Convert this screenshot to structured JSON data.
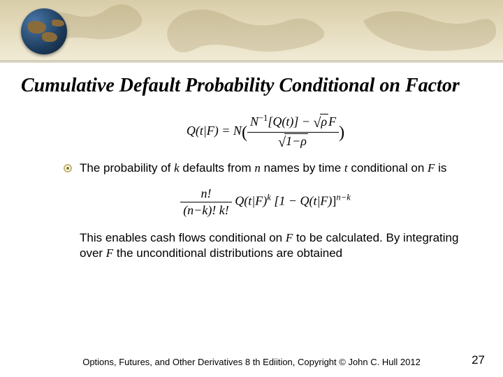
{
  "title": "Cumulative Default Probability Conditional on Factor",
  "formula1": {
    "lhs": "Q(t|F) = N",
    "num_a": "N",
    "num_inv": "−1",
    "num_b": "[Q(t)] − ",
    "num_sqrt": "ρ",
    "num_c": "F",
    "den_sqrt": "1−ρ"
  },
  "bullet": {
    "t1": "The probability of ",
    "k": "k",
    "t2": " defaults from ",
    "n": "n",
    "t3": " names by time ",
    "tt": "t",
    "t4": " conditional on ",
    "F": "F",
    "t5": " is"
  },
  "formula2": {
    "num": "n!",
    "den": "(n−k)! k!",
    "mid_a": "Q(t|F)",
    "exp_k": "k",
    "mid_b": "[1 − Q(t|F)",
    "mid_b_close": "]",
    "exp_nk": "n−k"
  },
  "para": {
    "p1": "This enables cash flows conditional on ",
    "F": "F",
    "p2": " to be calculated. By integrating over ",
    "F2": "F",
    "p3": " the unconditional distributions are obtained"
  },
  "footer": "Options, Futures, and Other Derivatives 8 th Ediition, Copyright © John C. Hull 2012",
  "pagenum": "27"
}
